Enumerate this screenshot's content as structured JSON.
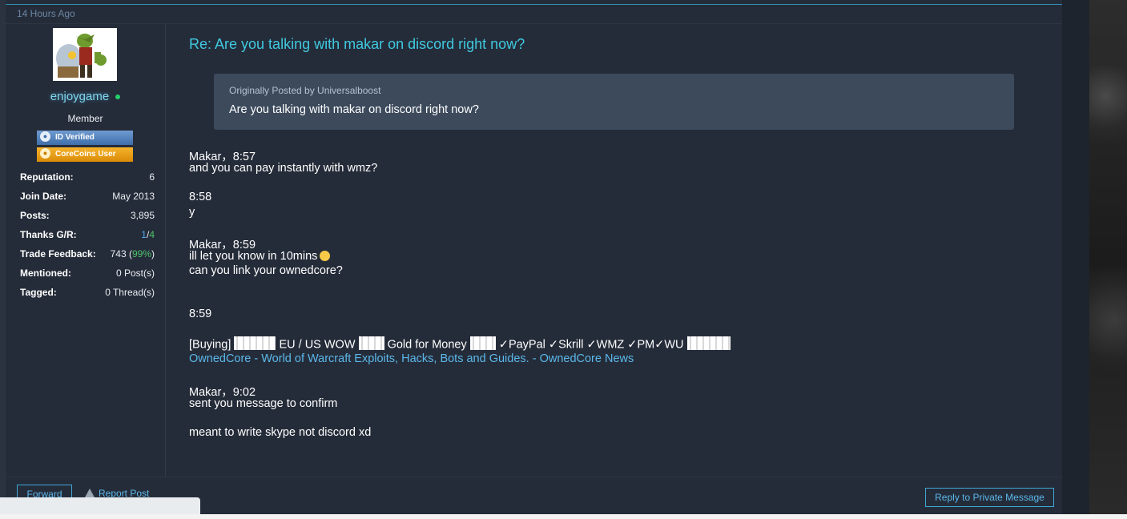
{
  "post": {
    "date": "14 Hours Ago",
    "title": "Re: Are you talking with makar on discord right now?"
  },
  "user": {
    "name": "enjoygame",
    "title": "Member",
    "badges": [
      "ID Verified",
      "CoreCoins User"
    ],
    "stats": [
      {
        "label": "Reputation:",
        "value": "6"
      },
      {
        "label": "Join Date:",
        "value": "May 2013"
      },
      {
        "label": "Posts:",
        "value": "3,895"
      },
      {
        "label": "Thanks G/R:",
        "given": "1",
        "received": "4"
      },
      {
        "label": "Trade Feedback:",
        "count": "743",
        "percent": "99%"
      },
      {
        "label": "Mentioned:",
        "value": "0 Post(s)"
      },
      {
        "label": "Tagged:",
        "value": "0 Thread(s)"
      }
    ]
  },
  "quote": {
    "author": "Originally Posted by Universalboost",
    "text": "Are you talking with makar on discord right now?"
  },
  "message": {
    "l1": "Makar，8:57",
    "l2": "and you can pay instantly with wmz?",
    "l3": "8:58",
    "l4": "y",
    "l5": "Makar，8:59",
    "l6": "ill let you know in 10mins",
    "l7": "can you link your ownedcore?",
    "l8": "8:59",
    "buying": {
      "p1": "[Buying]",
      "p2": "EU / US WOW",
      "p3": "Gold for Money",
      "p4": "✓PayPal ✓Skrill ✓WMZ ✓PM✓WU"
    },
    "link": "OwnedCore - World of Warcraft Exploits, Hacks, Bots and Guides. - OwnedCore News",
    "l9": "Makar，9:02",
    "l10": "sent you message to confirm",
    "l11": "meant to write skype not discord xd"
  },
  "actions": {
    "forward": "Forward",
    "report": "Report Post",
    "reply": "Reply to Private Message"
  },
  "colors": {
    "accent": "#3fc9e0",
    "link": "#5ab8ea",
    "background": "#252c39",
    "quote_bg": "#3c4a5c"
  }
}
